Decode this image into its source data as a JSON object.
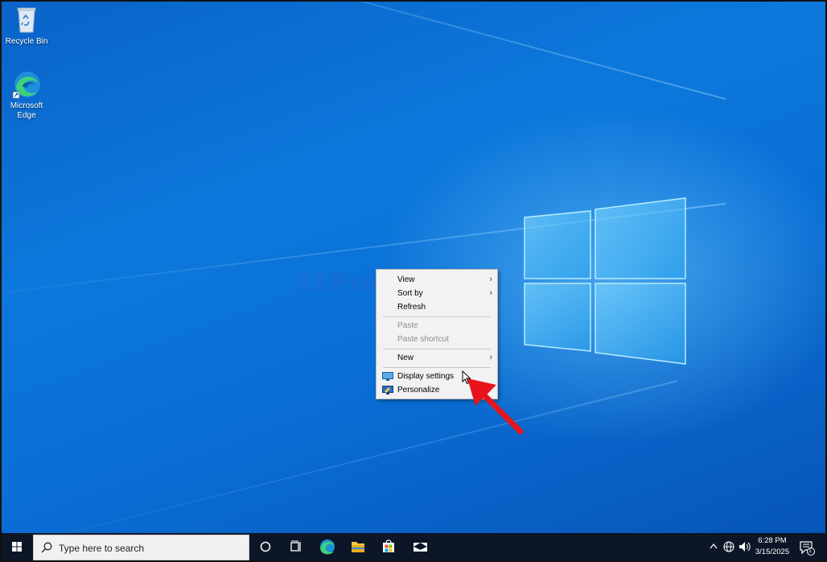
{
  "desktop": {
    "icons": [
      {
        "label": "Recycle Bin",
        "icon": "recycle-bin-icon"
      },
      {
        "label": "Microsoft Edge",
        "icon": "edge-icon"
      }
    ],
    "watermark": "ITProsHD"
  },
  "context_menu": {
    "items": [
      {
        "label": "View",
        "submenu": true,
        "enabled": true
      },
      {
        "label": "Sort by",
        "submenu": true,
        "enabled": true
      },
      {
        "label": "Refresh",
        "submenu": false,
        "enabled": true
      },
      {
        "label": "Paste",
        "submenu": false,
        "enabled": false
      },
      {
        "label": "Paste shortcut",
        "submenu": false,
        "enabled": false
      },
      {
        "label": "New",
        "submenu": true,
        "enabled": true
      },
      {
        "label": "Display settings",
        "submenu": false,
        "enabled": true,
        "icon": "display-icon"
      },
      {
        "label": "Personalize",
        "submenu": false,
        "enabled": true,
        "icon": "personalize-icon"
      }
    ]
  },
  "taskbar": {
    "search_placeholder": "Type here to search",
    "apps": [
      "cortana-icon",
      "task-view-icon",
      "edge-icon",
      "file-explorer-icon",
      "store-icon",
      "mail-icon"
    ],
    "tray": {
      "time": "6:28 PM",
      "date": "3/15/2025",
      "notification_count": "1"
    }
  },
  "colors": {
    "desktop_blue": "#0a6fd6",
    "taskbar": "#0d1626",
    "annotation_arrow": "#e8141c"
  }
}
